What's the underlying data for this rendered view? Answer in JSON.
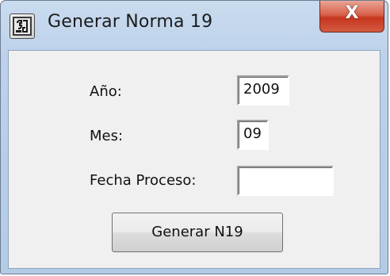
{
  "window": {
    "title": "Generar Norma 19",
    "close_glyph": "X",
    "app_icon": "app-icon"
  },
  "form": {
    "anio_label": "Año:",
    "anio_value": "2009",
    "mes_label": "Mes:",
    "mes_value": "09",
    "fecha_label": "Fecha Proceso:",
    "fecha_value": ""
  },
  "actions": {
    "generar_label": "Generar N19"
  },
  "colors": {
    "title_bar": "#b4cbe6",
    "client_bg": "#f0f0f0",
    "close_red": "#c5361f"
  }
}
